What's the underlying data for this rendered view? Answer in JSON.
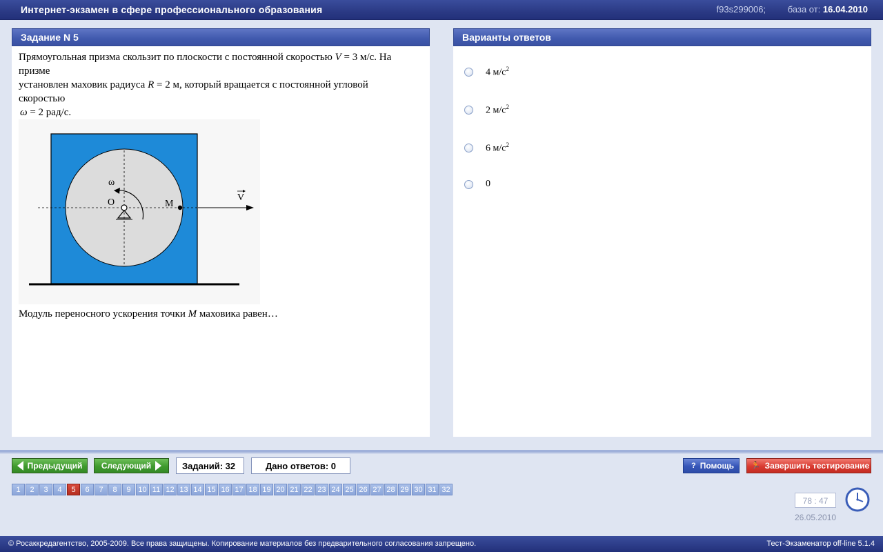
{
  "header": {
    "title": "Интернет-экзамен в сфере профессионального образования",
    "session_id": "f93s299006;",
    "base_label": "база от:",
    "base_date": "16.04.2010"
  },
  "task": {
    "heading": "Задание N 5",
    "line1_a": "Прямоугольная призма скользит по плоскости с постоянной скоростью ",
    "line1_var": "V",
    "line1_b": " = 3 м/с. На",
    "line2": "призме",
    "line3_a": "установлен маховик радиуса ",
    "line3_var": "R",
    "line3_b": " = 2 м, который вращается с постоянной угловой",
    "line4": "скоростью",
    "line5_var": "ω",
    "line5_b": " = 2 рад/с.",
    "question_a": "Модуль переносного ускорения точки ",
    "question_var": "M",
    "question_b": " маховика равен…",
    "figure_labels": {
      "omega": "ω",
      "center": "O",
      "point": "M",
      "velocity": "V"
    }
  },
  "answers": {
    "heading": "Варианты ответов",
    "options": [
      {
        "value": "4 м/с",
        "sup": "2"
      },
      {
        "value": "2 м/с",
        "sup": "2"
      },
      {
        "value": "6 м/с",
        "sup": "2"
      },
      {
        "value": "0",
        "sup": ""
      }
    ]
  },
  "controls": {
    "prev_label": "Предыдущий",
    "next_label": "Следующий",
    "tasks_count": "Заданий: 32",
    "answers_given": "Дано ответов: 0",
    "help_label": "Помощь",
    "finish_label": "Завершить тестирование"
  },
  "pages": {
    "numbers": [
      "1",
      "2",
      "3",
      "4",
      "5",
      "6",
      "7",
      "8",
      "9",
      "10",
      "11",
      "12",
      "13",
      "14",
      "15",
      "16",
      "17",
      "18",
      "19",
      "20",
      "21",
      "22",
      "23",
      "24",
      "25",
      "26",
      "27",
      "28",
      "29",
      "30",
      "31",
      "32"
    ],
    "active": "5"
  },
  "timer": {
    "value": "78 : 47",
    "date": "26.05.2010"
  },
  "footer": {
    "copyright": "© Росаккредагентство, 2005-2009. Все права защищены. Копирование материалов без предварительного согласования запрещено.",
    "version": "Тест-Экзаменатор off-line 5.1.4"
  },
  "colors": {
    "prism": "#1e8ad8",
    "disk": "#dcdcdc",
    "active_page": "#c23a2c"
  }
}
